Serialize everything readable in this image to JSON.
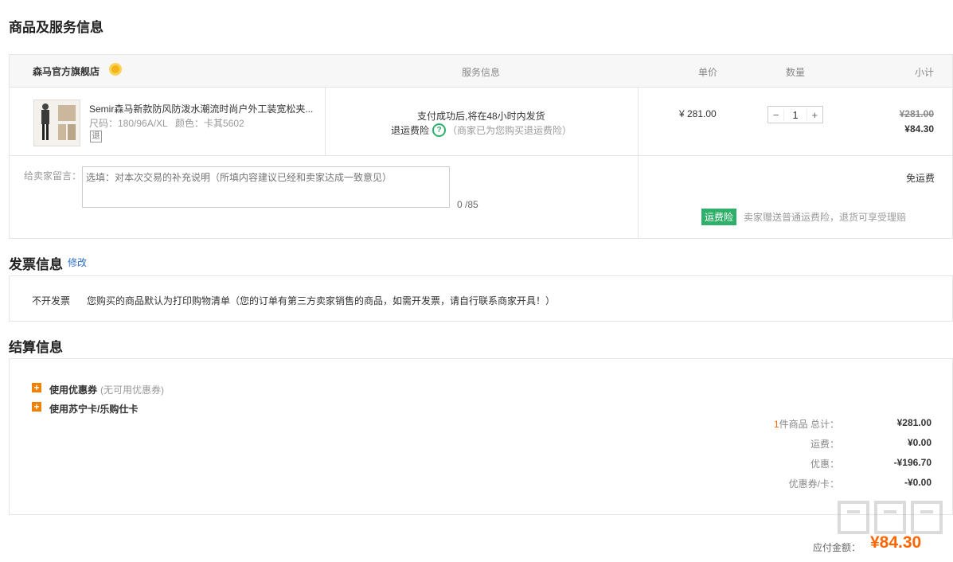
{
  "sections": {
    "goods_title": "商品及服务信息",
    "invoice_title": "发票信息",
    "invoice_edit": "修改",
    "settlement_title": "结算信息"
  },
  "table": {
    "store_name": "森马官方旗舰店",
    "col_service": "服务信息",
    "col_price": "单价",
    "col_qty": "数量",
    "col_subtotal": "小计"
  },
  "item": {
    "title": "Semir森马新款防风防泼水潮流时尚户外工装宽松夹...",
    "size": "尺码：180/96A/XL",
    "color": "颜色：卡其5602",
    "return_tag": "退",
    "service_line": "支付成功后,将在48小时内发货",
    "insurance_label": "退运费险",
    "insurance_note": "（商家已为您购买退运费险）",
    "unit_price": "¥ 281.00",
    "qty_minus": "−",
    "qty_value": "1",
    "qty_plus": "+",
    "original_subtotal": "¥281.00",
    "subtotal": "¥84.30"
  },
  "message": {
    "label": "给卖家留言：",
    "placeholder": "选填：对本次交易的补充说明（所填内容建议已经和卖家达成一致意见）",
    "counter": "0 /85",
    "shipping": "免运费",
    "insurance_badge": "运费险",
    "insurance_desc": "卖家赠送普通运费险，退货可享受理赔"
  },
  "invoice": {
    "type": "不开发票",
    "desc": "您购买的商品默认为打印购物清单（您的订单有第三方卖家销售的商品，如需开发票，请自行联系商家开具！）"
  },
  "settlement": {
    "coupon_label": "使用优惠券",
    "coupon_note": "(无可用优惠券)",
    "card_label": "使用苏宁卡/乐购仕卡",
    "count": "1",
    "count_suffix": "件商品 总计：",
    "total": "¥281.00",
    "shipping_label": "运费：",
    "shipping_value": "¥0.00",
    "discount_label": "优惠：",
    "discount_value": "-¥196.70",
    "coupon_card_label": "优惠券/卡：",
    "coupon_card_value": "-¥0.00",
    "payable_label": "应付金额：",
    "payable_value": "¥84.30"
  },
  "watermark": "什么值得买",
  "colors": {
    "accent": "#ff6600",
    "green": "#2fb06a",
    "link": "#2a6fc9"
  }
}
